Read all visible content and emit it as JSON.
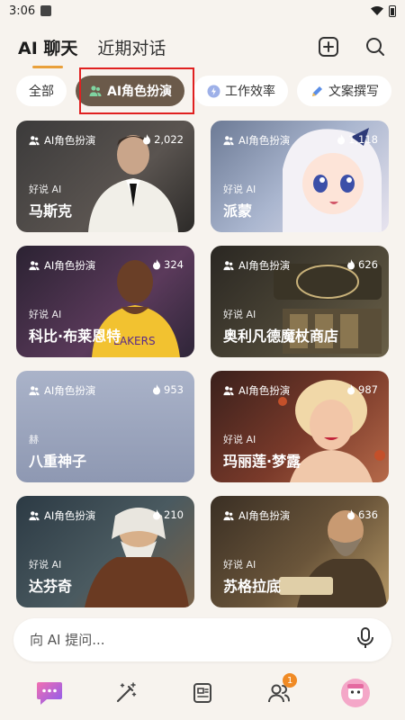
{
  "status_bar": {
    "time": "3:06"
  },
  "header": {
    "tabs": [
      {
        "label": "AI 聊天",
        "active": true
      },
      {
        "label": "近期对话",
        "active": false
      }
    ],
    "icons": [
      "add-square-icon",
      "search-icon"
    ]
  },
  "chips": [
    {
      "label": "全部",
      "active": false
    },
    {
      "label": "AI角色扮演",
      "active": true,
      "icon": "users-icon"
    },
    {
      "label": "工作效率",
      "active": false,
      "icon": "lightning-icon"
    },
    {
      "label": "文案撰写",
      "active": false,
      "icon": "pen-icon"
    }
  ],
  "cards": [
    {
      "tag": "AI角色扮演",
      "count": "2,022",
      "author": "好说 AI",
      "name": "马斯克"
    },
    {
      "tag": "AI角色扮演",
      "count": "1,118",
      "author": "好说 AI",
      "name": "派蒙"
    },
    {
      "tag": "AI角色扮演",
      "count": "324",
      "author": "好说 AI",
      "name": "科比·布莱恩特"
    },
    {
      "tag": "AI角色扮演",
      "count": "626",
      "author": "好说 AI",
      "name": "奥利凡德魔杖商店"
    },
    {
      "tag": "AI角色扮演",
      "count": "953",
      "author": "赫",
      "name": "八重神子"
    },
    {
      "tag": "AI角色扮演",
      "count": "987",
      "author": "好说 AI",
      "name": "玛丽莲·梦露"
    },
    {
      "tag": "AI角色扮演",
      "count": "210",
      "author": "好说 AI",
      "name": "达芬奇"
    },
    {
      "tag": "AI角色扮演",
      "count": "636",
      "author": "好说 AI",
      "name": "苏格拉底"
    }
  ],
  "input": {
    "placeholder": "向 AI 提问..."
  },
  "bottom_nav": {
    "items": [
      "chat-icon",
      "magic-wand-icon",
      "news-icon",
      "users-icon",
      "avatar"
    ],
    "badge": "1"
  },
  "colors": {
    "accent": "#e9a03a",
    "chip_active": "#6b5a4a",
    "badge": "#f08a24",
    "highlight": "#e02020"
  }
}
